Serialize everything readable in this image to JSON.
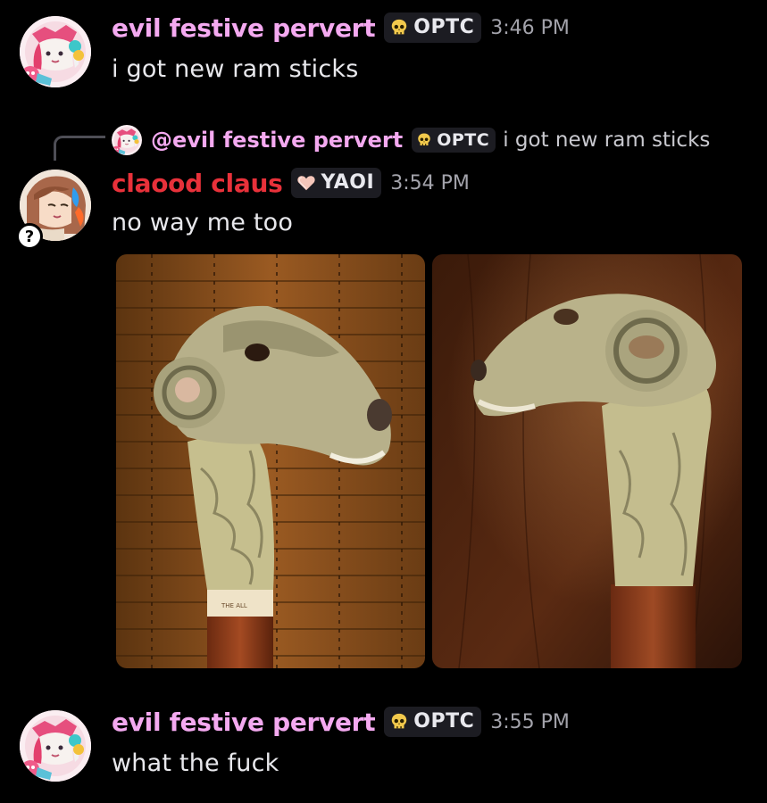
{
  "messages": [
    {
      "username": "evil festive pervert",
      "name_color": "#f4a9f0",
      "tag": "OPTC",
      "tag_icon": "skull-icon",
      "timestamp": "3:46 PM",
      "text": "i got new ram sticks"
    },
    {
      "reply": {
        "username": "@evil festive pervert",
        "tag": "OPTC",
        "text": "i got new ram sticks"
      },
      "username": "claood claus",
      "name_color": "#e8313a",
      "tag": "YAOI",
      "tag_icon": "heart-icon",
      "timestamp": "3:54 PM",
      "text": "no way me too",
      "avatar_badge": "?",
      "attachments": [
        {
          "name": "ram-head-cane-photo-bamboo-background"
        },
        {
          "name": "ram-head-cane-photo-wood-background"
        }
      ]
    },
    {
      "username": "evil festive pervert",
      "name_color": "#f4a9f0",
      "tag": "OPTC",
      "tag_icon": "skull-icon",
      "timestamp": "3:55 PM",
      "text": "what the fuck"
    }
  ],
  "label_on_cane": "THE ALL"
}
